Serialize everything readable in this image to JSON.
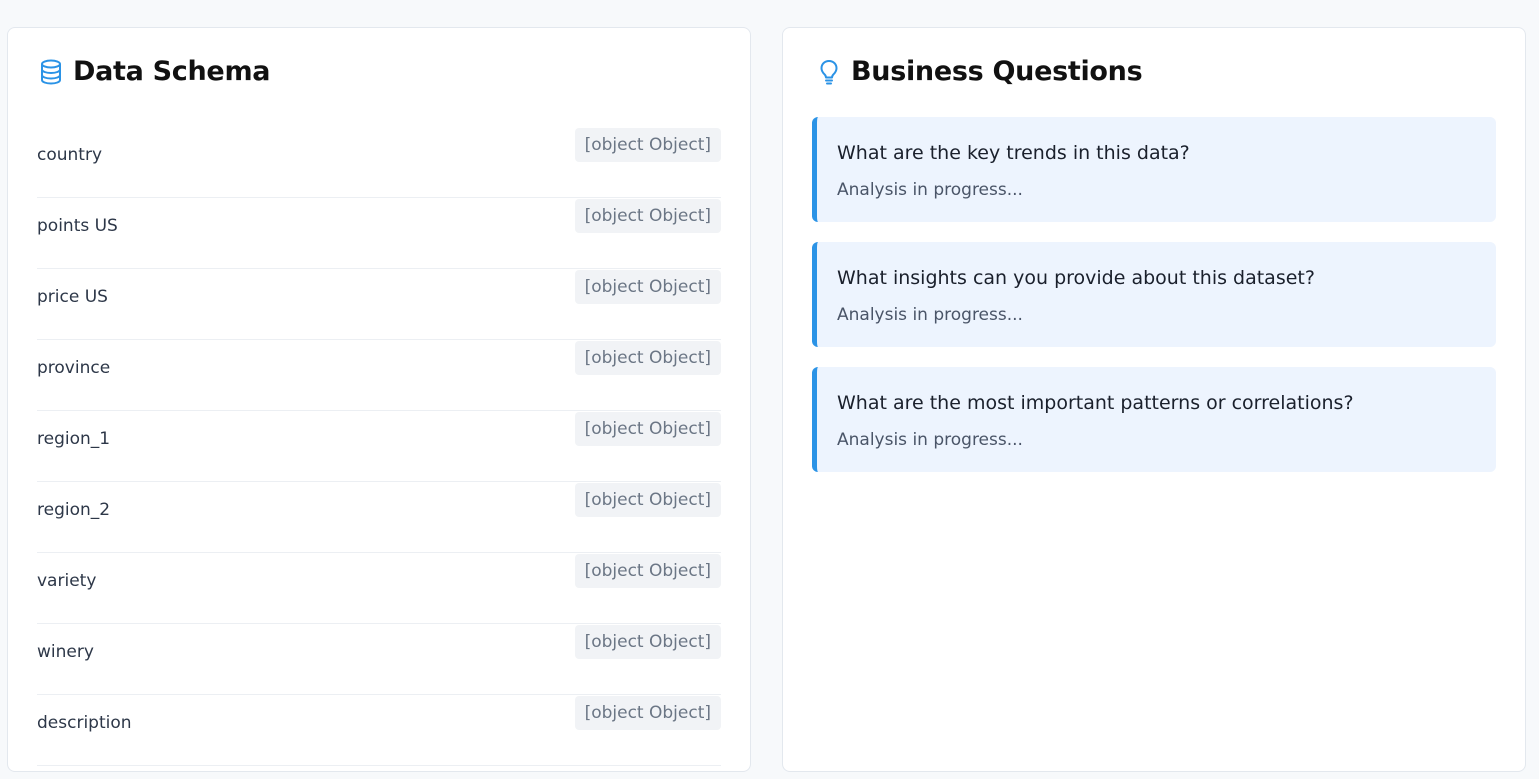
{
  "schema": {
    "title": "Data Schema",
    "icon": "database-icon",
    "fields": [
      {
        "name": "country",
        "type": "[object Object]"
      },
      {
        "name": "points US",
        "type": "[object Object]"
      },
      {
        "name": "price US",
        "type": "[object Object]"
      },
      {
        "name": "province",
        "type": "[object Object]"
      },
      {
        "name": "region_1",
        "type": "[object Object]"
      },
      {
        "name": "region_2",
        "type": "[object Object]"
      },
      {
        "name": "variety",
        "type": "[object Object]"
      },
      {
        "name": "winery",
        "type": "[object Object]"
      },
      {
        "name": "description",
        "type": "[object Object]"
      }
    ]
  },
  "questions": {
    "title": "Business Questions",
    "icon": "lightbulb-icon",
    "items": [
      {
        "question": "What are the key trends in this data?",
        "status": "Analysis in progress..."
      },
      {
        "question": "What insights can you provide about this dataset?",
        "status": "Analysis in progress..."
      },
      {
        "question": "What are the most important patterns or correlations?",
        "status": "Analysis in progress..."
      }
    ]
  },
  "colors": {
    "accent": "#2b93e6",
    "card_background": "#edf4fe",
    "type_badge_background": "#f1f3f6"
  }
}
